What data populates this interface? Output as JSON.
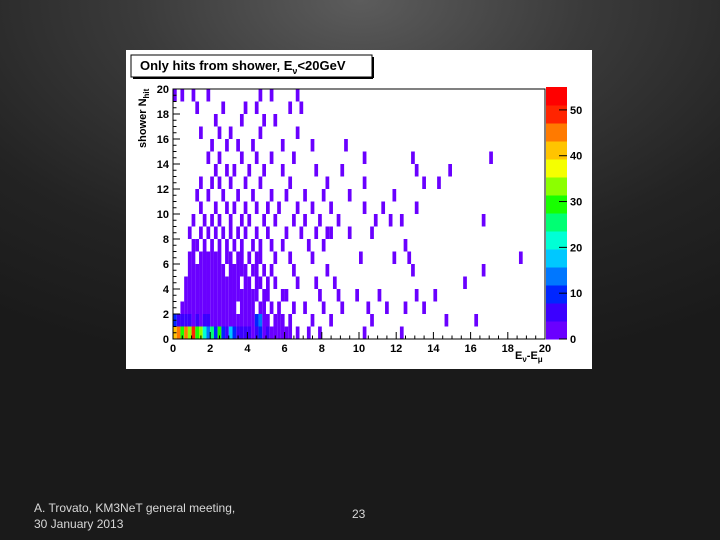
{
  "footer": {
    "credit_line1": "A. Trovato, KM3NeT general meeting,",
    "credit_line2": "30 January 2013",
    "page_number": "23"
  },
  "chart_data": {
    "type": "heatmap",
    "title": "Only hits from shower, Eν<20GeV",
    "title_main": "Only hits from shower, E",
    "title_sub": "ν",
    "title_tail": "<20GeV",
    "xlabel": "Eν-Eμ",
    "ylabel": "shower N_hit",
    "xlim": [
      0,
      20
    ],
    "ylim": [
      0,
      20
    ],
    "x_ticks": [
      0,
      2,
      4,
      6,
      8,
      10,
      12,
      14,
      16,
      18,
      20
    ],
    "y_ticks": [
      0,
      2,
      4,
      6,
      8,
      10,
      12,
      14,
      16,
      18,
      20
    ],
    "colorbar": {
      "range": [
        0,
        55
      ],
      "ticks": [
        0,
        10,
        20,
        30,
        40,
        50
      ],
      "colors": [
        "#6a00ff",
        "#3b00ff",
        "#0026ff",
        "#0077ff",
        "#00c8ff",
        "#00ffd5",
        "#00ff73",
        "#18ff00",
        "#8cff00",
        "#f5ff00",
        "#ffc400",
        "#ff7a00",
        "#ff2400",
        "#ff0000"
      ]
    },
    "bin_width_x": 0.2,
    "bin_height_y": 1,
    "cells": [
      [
        0.0,
        0,
        40
      ],
      [
        0.2,
        0,
        45
      ],
      [
        0.4,
        0,
        30
      ],
      [
        0.6,
        0,
        45
      ],
      [
        0.8,
        0,
        35
      ],
      [
        1.0,
        0,
        50
      ],
      [
        1.2,
        0,
        30
      ],
      [
        1.4,
        0,
        35
      ],
      [
        1.6,
        0,
        20
      ],
      [
        1.8,
        0,
        15
      ],
      [
        2.0,
        0,
        25
      ],
      [
        2.2,
        0,
        8
      ],
      [
        2.4,
        0,
        30
      ],
      [
        2.6,
        0,
        10
      ],
      [
        2.8,
        0,
        6
      ],
      [
        3.0,
        0,
        18
      ],
      [
        3.2,
        0,
        8
      ],
      [
        3.4,
        0,
        5
      ],
      [
        3.6,
        0,
        7
      ],
      [
        3.8,
        0,
        4
      ],
      [
        4.0,
        0,
        6
      ],
      [
        4.2,
        0,
        3
      ],
      [
        4.4,
        0,
        5
      ],
      [
        4.6,
        0,
        9
      ],
      [
        4.8,
        0,
        2
      ],
      [
        5.0,
        0,
        4
      ],
      [
        5.2,
        0,
        2
      ],
      [
        5.4,
        0,
        3
      ],
      [
        5.6,
        0,
        1
      ],
      [
        5.8,
        0,
        2
      ],
      [
        6.0,
        0,
        1
      ],
      [
        6.2,
        0,
        1
      ],
      [
        6.6,
        0,
        1
      ],
      [
        7.2,
        0,
        1
      ],
      [
        7.8,
        0,
        1
      ],
      [
        10.2,
        0,
        1
      ],
      [
        12.2,
        0,
        1
      ],
      [
        0.0,
        1,
        8
      ],
      [
        0.2,
        1,
        6
      ],
      [
        0.4,
        1,
        5
      ],
      [
        0.6,
        1,
        4
      ],
      [
        0.8,
        1,
        5
      ],
      [
        1.0,
        1,
        3
      ],
      [
        1.2,
        1,
        4
      ],
      [
        1.4,
        1,
        3
      ],
      [
        1.6,
        1,
        5
      ],
      [
        1.8,
        1,
        4
      ],
      [
        2.0,
        1,
        3
      ],
      [
        2.2,
        1,
        2
      ],
      [
        2.4,
        1,
        3
      ],
      [
        2.6,
        1,
        2
      ],
      [
        2.8,
        1,
        3
      ],
      [
        3.0,
        1,
        2
      ],
      [
        3.2,
        1,
        1
      ],
      [
        3.4,
        1,
        2
      ],
      [
        3.6,
        1,
        1
      ],
      [
        3.8,
        1,
        3
      ],
      [
        4.0,
        1,
        2
      ],
      [
        4.2,
        1,
        1
      ],
      [
        4.4,
        1,
        8
      ],
      [
        4.6,
        1,
        15
      ],
      [
        4.8,
        1,
        2
      ],
      [
        5.0,
        1,
        1
      ],
      [
        5.4,
        1,
        1
      ],
      [
        5.6,
        1,
        2
      ],
      [
        5.8,
        1,
        1
      ],
      [
        6.2,
        1,
        1
      ],
      [
        7.4,
        1,
        1
      ],
      [
        8.4,
        1,
        1
      ],
      [
        10.6,
        1,
        1
      ],
      [
        14.6,
        1,
        1
      ],
      [
        16.2,
        1,
        1
      ],
      [
        0.4,
        2,
        2
      ],
      [
        0.6,
        2,
        3
      ],
      [
        0.8,
        2,
        2
      ],
      [
        1.0,
        2,
        2
      ],
      [
        1.2,
        2,
        3
      ],
      [
        1.4,
        2,
        1
      ],
      [
        1.6,
        2,
        2
      ],
      [
        1.8,
        2,
        3
      ],
      [
        2.0,
        2,
        1
      ],
      [
        2.2,
        2,
        2
      ],
      [
        2.4,
        2,
        1
      ],
      [
        2.6,
        2,
        2
      ],
      [
        2.8,
        2,
        1
      ],
      [
        3.0,
        2,
        2
      ],
      [
        3.2,
        2,
        1
      ],
      [
        3.6,
        2,
        1
      ],
      [
        3.8,
        2,
        2
      ],
      [
        4.0,
        2,
        1
      ],
      [
        4.2,
        2,
        1
      ],
      [
        4.6,
        2,
        1
      ],
      [
        4.8,
        2,
        2
      ],
      [
        5.2,
        2,
        1
      ],
      [
        5.6,
        2,
        1
      ],
      [
        6.4,
        2,
        1
      ],
      [
        7.0,
        2,
        1
      ],
      [
        8.0,
        2,
        1
      ],
      [
        9.0,
        2,
        1
      ],
      [
        10.4,
        2,
        1
      ],
      [
        11.4,
        2,
        1
      ],
      [
        12.4,
        2,
        1
      ],
      [
        13.4,
        2,
        1
      ],
      [
        0.6,
        3,
        2
      ],
      [
        0.8,
        3,
        1
      ],
      [
        1.0,
        3,
        2
      ],
      [
        1.2,
        3,
        3
      ],
      [
        1.4,
        3,
        2
      ],
      [
        1.6,
        3,
        1
      ],
      [
        1.8,
        3,
        3
      ],
      [
        2.0,
        3,
        2
      ],
      [
        2.2,
        3,
        2
      ],
      [
        2.4,
        3,
        1
      ],
      [
        2.6,
        3,
        2
      ],
      [
        2.8,
        3,
        1
      ],
      [
        3.0,
        3,
        3
      ],
      [
        3.2,
        3,
        2
      ],
      [
        3.4,
        3,
        1
      ],
      [
        3.6,
        3,
        2
      ],
      [
        3.8,
        3,
        1
      ],
      [
        4.0,
        3,
        2
      ],
      [
        4.2,
        3,
        1
      ],
      [
        4.4,
        3,
        2
      ],
      [
        4.8,
        3,
        1
      ],
      [
        5.0,
        3,
        1
      ],
      [
        5.8,
        3,
        1
      ],
      [
        6.0,
        3,
        1
      ],
      [
        7.8,
        3,
        1
      ],
      [
        8.8,
        3,
        1
      ],
      [
        9.8,
        3,
        1
      ],
      [
        11.0,
        3,
        1
      ],
      [
        13.0,
        3,
        1
      ],
      [
        14.0,
        3,
        1
      ],
      [
        0.6,
        4,
        1
      ],
      [
        0.8,
        4,
        2
      ],
      [
        1.0,
        4,
        1
      ],
      [
        1.2,
        4,
        2
      ],
      [
        1.4,
        4,
        3
      ],
      [
        1.6,
        4,
        2
      ],
      [
        1.8,
        4,
        1
      ],
      [
        2.0,
        4,
        2
      ],
      [
        2.2,
        4,
        3
      ],
      [
        2.4,
        4,
        1
      ],
      [
        2.6,
        4,
        2
      ],
      [
        2.8,
        4,
        1
      ],
      [
        3.0,
        4,
        1
      ],
      [
        3.2,
        4,
        2
      ],
      [
        3.4,
        4,
        1
      ],
      [
        3.8,
        4,
        2
      ],
      [
        4.0,
        4,
        1
      ],
      [
        4.4,
        4,
        1
      ],
      [
        4.6,
        4,
        2
      ],
      [
        5.0,
        4,
        1
      ],
      [
        5.4,
        4,
        1
      ],
      [
        6.6,
        4,
        1
      ],
      [
        7.6,
        4,
        1
      ],
      [
        8.6,
        4,
        1
      ],
      [
        15.6,
        4,
        1
      ],
      [
        0.8,
        5,
        1
      ],
      [
        1.0,
        5,
        2
      ],
      [
        1.2,
        5,
        1
      ],
      [
        1.4,
        5,
        2
      ],
      [
        1.6,
        5,
        3
      ],
      [
        1.8,
        5,
        1
      ],
      [
        2.0,
        5,
        2
      ],
      [
        2.2,
        5,
        1
      ],
      [
        2.4,
        5,
        2
      ],
      [
        2.6,
        5,
        1
      ],
      [
        3.0,
        5,
        2
      ],
      [
        3.2,
        5,
        1
      ],
      [
        3.4,
        5,
        2
      ],
      [
        3.6,
        5,
        1
      ],
      [
        3.8,
        5,
        1
      ],
      [
        4.2,
        5,
        2
      ],
      [
        4.4,
        5,
        1
      ],
      [
        4.8,
        5,
        1
      ],
      [
        5.2,
        5,
        1
      ],
      [
        6.4,
        5,
        1
      ],
      [
        8.2,
        5,
        1
      ],
      [
        12.8,
        5,
        1
      ],
      [
        16.6,
        5,
        1
      ],
      [
        0.8,
        6,
        2
      ],
      [
        1.0,
        6,
        1
      ],
      [
        1.4,
        6,
        1
      ],
      [
        1.6,
        6,
        2
      ],
      [
        1.8,
        6,
        1
      ],
      [
        2.0,
        6,
        1
      ],
      [
        2.2,
        6,
        2
      ],
      [
        2.4,
        6,
        1
      ],
      [
        2.8,
        6,
        1
      ],
      [
        3.0,
        6,
        1
      ],
      [
        3.4,
        6,
        1
      ],
      [
        3.6,
        6,
        2
      ],
      [
        4.0,
        6,
        1
      ],
      [
        4.4,
        6,
        1
      ],
      [
        4.6,
        6,
        1
      ],
      [
        5.4,
        6,
        1
      ],
      [
        6.2,
        6,
        1
      ],
      [
        7.4,
        6,
        1
      ],
      [
        10.0,
        6,
        1
      ],
      [
        11.8,
        6,
        1
      ],
      [
        12.6,
        6,
        1
      ],
      [
        18.6,
        6,
        1
      ],
      [
        1.0,
        7,
        1
      ],
      [
        1.2,
        7,
        1
      ],
      [
        1.6,
        7,
        1
      ],
      [
        2.0,
        7,
        2
      ],
      [
        2.4,
        7,
        1
      ],
      [
        2.8,
        7,
        1
      ],
      [
        3.2,
        7,
        1
      ],
      [
        3.6,
        7,
        1
      ],
      [
        4.2,
        7,
        1
      ],
      [
        4.6,
        7,
        1
      ],
      [
        5.2,
        7,
        1
      ],
      [
        5.8,
        7,
        1
      ],
      [
        7.2,
        7,
        1
      ],
      [
        8.0,
        7,
        1
      ],
      [
        12.4,
        7,
        1
      ],
      [
        0.8,
        8,
        1
      ],
      [
        1.4,
        8,
        1
      ],
      [
        1.8,
        8,
        1
      ],
      [
        2.2,
        8,
        1
      ],
      [
        2.6,
        8,
        1
      ],
      [
        3.0,
        8,
        1
      ],
      [
        3.4,
        8,
        1
      ],
      [
        3.8,
        8,
        1
      ],
      [
        4.4,
        8,
        1
      ],
      [
        5.0,
        8,
        1
      ],
      [
        6.0,
        8,
        1
      ],
      [
        6.8,
        8,
        1
      ],
      [
        7.6,
        8,
        1
      ],
      [
        8.2,
        8,
        1
      ],
      [
        8.4,
        8,
        1
      ],
      [
        9.4,
        8,
        1
      ],
      [
        10.6,
        8,
        1
      ],
      [
        1.0,
        9,
        1
      ],
      [
        1.6,
        9,
        1
      ],
      [
        2.0,
        9,
        1
      ],
      [
        2.4,
        9,
        1
      ],
      [
        3.0,
        9,
        1
      ],
      [
        3.6,
        9,
        1
      ],
      [
        4.0,
        9,
        1
      ],
      [
        4.8,
        9,
        1
      ],
      [
        5.4,
        9,
        1
      ],
      [
        6.4,
        9,
        1
      ],
      [
        7.0,
        9,
        1
      ],
      [
        7.8,
        9,
        1
      ],
      [
        8.8,
        9,
        1
      ],
      [
        10.8,
        9,
        1
      ],
      [
        11.6,
        9,
        1
      ],
      [
        12.2,
        9,
        1
      ],
      [
        16.6,
        9,
        1
      ],
      [
        1.4,
        10,
        1
      ],
      [
        2.2,
        10,
        1
      ],
      [
        2.8,
        10,
        1
      ],
      [
        3.2,
        10,
        1
      ],
      [
        3.8,
        10,
        1
      ],
      [
        4.4,
        10,
        1
      ],
      [
        5.0,
        10,
        1
      ],
      [
        5.6,
        10,
        1
      ],
      [
        6.6,
        10,
        1
      ],
      [
        7.4,
        10,
        1
      ],
      [
        8.4,
        10,
        1
      ],
      [
        10.2,
        10,
        1
      ],
      [
        11.2,
        10,
        1
      ],
      [
        13.0,
        10,
        1
      ],
      [
        1.2,
        11,
        1
      ],
      [
        1.8,
        11,
        1
      ],
      [
        2.6,
        11,
        1
      ],
      [
        3.4,
        11,
        1
      ],
      [
        4.2,
        11,
        1
      ],
      [
        5.2,
        11,
        1
      ],
      [
        6.0,
        11,
        1
      ],
      [
        7.0,
        11,
        1
      ],
      [
        8.0,
        11,
        1
      ],
      [
        9.4,
        11,
        1
      ],
      [
        11.8,
        11,
        1
      ],
      [
        1.4,
        12,
        1
      ],
      [
        2.0,
        12,
        1
      ],
      [
        2.4,
        12,
        1
      ],
      [
        3.0,
        12,
        1
      ],
      [
        3.8,
        12,
        1
      ],
      [
        4.6,
        12,
        1
      ],
      [
        6.2,
        12,
        1
      ],
      [
        8.2,
        12,
        1
      ],
      [
        10.2,
        12,
        1
      ],
      [
        13.4,
        12,
        1
      ],
      [
        14.2,
        12,
        1
      ],
      [
        2.2,
        13,
        1
      ],
      [
        2.8,
        13,
        1
      ],
      [
        3.2,
        13,
        1
      ],
      [
        4.0,
        13,
        1
      ],
      [
        4.8,
        13,
        1
      ],
      [
        5.8,
        13,
        1
      ],
      [
        7.6,
        13,
        1
      ],
      [
        9.0,
        13,
        1
      ],
      [
        13.0,
        13,
        1
      ],
      [
        14.8,
        13,
        1
      ],
      [
        1.8,
        14,
        1
      ],
      [
        2.4,
        14,
        1
      ],
      [
        3.6,
        14,
        1
      ],
      [
        4.4,
        14,
        1
      ],
      [
        5.2,
        14,
        1
      ],
      [
        6.4,
        14,
        1
      ],
      [
        10.2,
        14,
        1
      ],
      [
        12.8,
        14,
        1
      ],
      [
        17.0,
        14,
        1
      ],
      [
        2.0,
        15,
        1
      ],
      [
        2.8,
        15,
        1
      ],
      [
        3.4,
        15,
        1
      ],
      [
        4.2,
        15,
        1
      ],
      [
        5.8,
        15,
        1
      ],
      [
        7.4,
        15,
        1
      ],
      [
        9.2,
        15,
        1
      ],
      [
        1.4,
        16,
        1
      ],
      [
        2.4,
        16,
        1
      ],
      [
        3.0,
        16,
        1
      ],
      [
        4.6,
        16,
        1
      ],
      [
        6.6,
        16,
        1
      ],
      [
        2.2,
        17,
        1
      ],
      [
        3.6,
        17,
        1
      ],
      [
        4.8,
        17,
        1
      ],
      [
        5.4,
        17,
        1
      ],
      [
        1.2,
        18,
        1
      ],
      [
        2.6,
        18,
        1
      ],
      [
        3.8,
        18,
        1
      ],
      [
        4.4,
        18,
        1
      ],
      [
        6.2,
        18,
        1
      ],
      [
        6.8,
        18,
        1
      ],
      [
        0.0,
        19,
        1
      ],
      [
        0.4,
        19,
        1
      ],
      [
        1.0,
        19,
        1
      ],
      [
        1.8,
        19,
        1
      ],
      [
        4.6,
        19,
        1
      ],
      [
        5.2,
        19,
        1
      ],
      [
        6.6,
        19,
        1
      ]
    ]
  }
}
